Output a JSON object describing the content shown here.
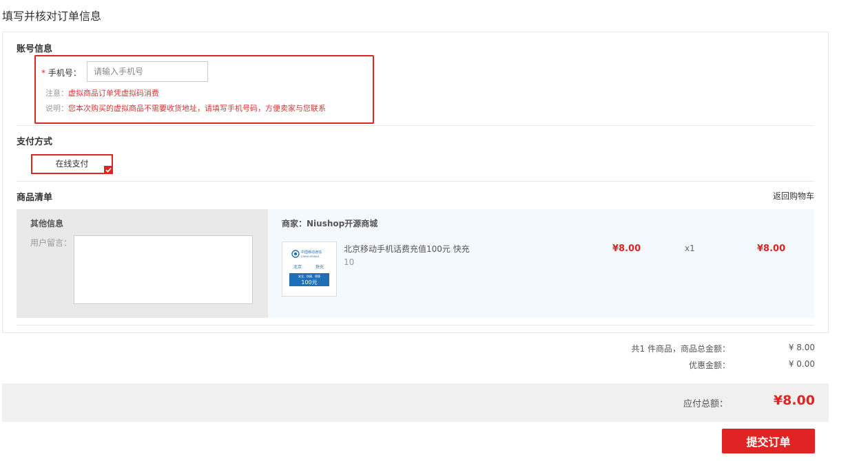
{
  "page_title": "填写并核对订单信息",
  "account": {
    "section_title": "账号信息",
    "required_mark": "*",
    "phone_label": "手机号：",
    "phone_placeholder": "请输入手机号",
    "phone_value": "",
    "note_prefix": "注意：",
    "note_text": "虚拟商品订单凭虚拟码消费",
    "explain_prefix": "说明：",
    "explain_text": "您本次购买的虚拟商品不需要收货地址，请填写手机号码，方便卖家与您联系"
  },
  "payment": {
    "section_title": "支付方式",
    "option_label": "在线支付",
    "selected": true
  },
  "goods": {
    "section_title": "商品清单",
    "back_to_cart": "返回购物车",
    "other_info_title": "其他信息",
    "message_label": "用户留言：",
    "message_value": "",
    "shop_label": "商家：Niushop开源商城",
    "items": [
      {
        "name": "北京移动手机话费充值100元 快充",
        "spec": "10",
        "price": "¥8.00",
        "quantity": "x1",
        "subtotal": "¥8.00",
        "thumb": {
          "brand_cn": "中国移动通信",
          "brand_en": "CHINA MOBILE",
          "city": "北京",
          "speed": "快充",
          "slogan": "安全、快捷、便捷",
          "amount": "100元"
        }
      }
    ]
  },
  "summary": {
    "count_label": "共1 件商品，商品总金额：",
    "goods_total": "¥ 8.00",
    "discount_label": "优惠金额：",
    "discount": "¥ 0.00",
    "payable_label": "应付总额：",
    "payable": "¥8.00"
  },
  "submit_label": "提交订单",
  "colors": {
    "accent": "#e02424",
    "panel_gray": "#e9e9e9",
    "goods_bg": "#f3f9fc",
    "mobile_blue": "#1f6fb8"
  }
}
